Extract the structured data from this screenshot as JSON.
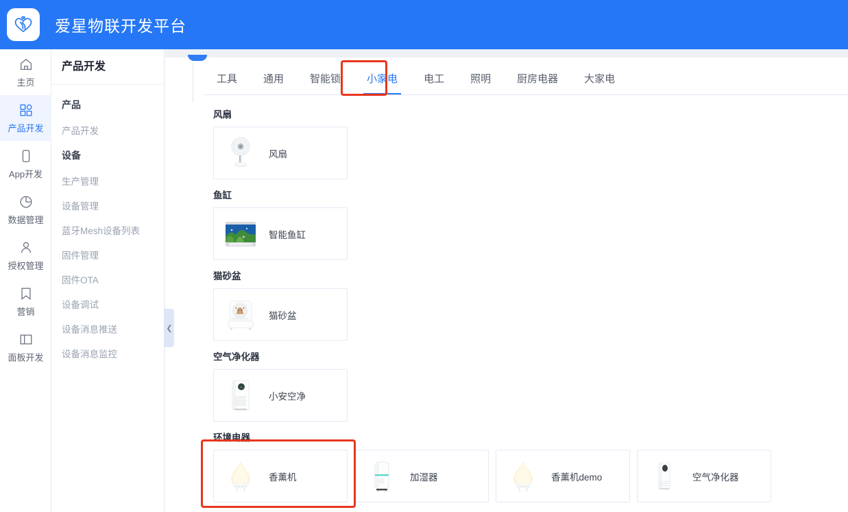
{
  "header": {
    "title": "爱星物联开发平台",
    "logo_icon": "heart-wifi-logo-icon",
    "brand_color": "#2577f5"
  },
  "rail": {
    "items": [
      {
        "label": "主页",
        "icon": "home-icon",
        "active": false
      },
      {
        "label": "产品开发",
        "icon": "grid-icon",
        "active": true
      },
      {
        "label": "App开发",
        "icon": "phone-icon",
        "active": false
      },
      {
        "label": "数据管理",
        "icon": "pie-chart-icon",
        "active": false
      },
      {
        "label": "授权管理",
        "icon": "user-icon",
        "active": false
      },
      {
        "label": "营销",
        "icon": "bookmark-icon",
        "active": false
      },
      {
        "label": "面板开发",
        "icon": "panel-icon",
        "active": false
      }
    ]
  },
  "submenu": {
    "title": "产品开发",
    "entries": [
      {
        "label": "产品",
        "type": "group"
      },
      {
        "label": "产品开发",
        "type": "item"
      },
      {
        "label": "设备",
        "type": "group"
      },
      {
        "label": "生产管理",
        "type": "item"
      },
      {
        "label": "设备管理",
        "type": "item"
      },
      {
        "label": "蓝牙Mesh设备列表",
        "type": "item"
      },
      {
        "label": "固件管理",
        "type": "item"
      },
      {
        "label": "固件OTA",
        "type": "item"
      },
      {
        "label": "设备调试",
        "type": "item"
      },
      {
        "label": "设备消息推送",
        "type": "item"
      },
      {
        "label": "设备消息监控",
        "type": "item"
      }
    ],
    "collapse_icon": "chevron-left-icon"
  },
  "tabs": [
    {
      "label": "工具",
      "active": false
    },
    {
      "label": "通用",
      "active": false
    },
    {
      "label": "智能锁",
      "active": false
    },
    {
      "label": "小家电",
      "active": true
    },
    {
      "label": "电工",
      "active": false
    },
    {
      "label": "照明",
      "active": false
    },
    {
      "label": "厨房电器",
      "active": false
    },
    {
      "label": "大家电",
      "active": false
    }
  ],
  "sections": [
    {
      "title": "风扇",
      "cards": [
        {
          "label": "风扇",
          "thumb": "pedestal-fan-thumb"
        }
      ]
    },
    {
      "title": "鱼缸",
      "cards": [
        {
          "label": "智能鱼缸",
          "thumb": "aquarium-thumb"
        }
      ]
    },
    {
      "title": "猫砂盆",
      "cards": [
        {
          "label": "猫砂盆",
          "thumb": "cat-litter-box-thumb"
        }
      ]
    },
    {
      "title": "空气净化器",
      "cards": [
        {
          "label": "小安空净",
          "thumb": "air-purifier-tower-thumb"
        }
      ]
    },
    {
      "title": "环境电器",
      "cards": [
        {
          "label": "香薰机",
          "thumb": "aroma-diffuser-thumb"
        },
        {
          "label": "加湿器",
          "thumb": "humidifier-thumb"
        },
        {
          "label": "香薰机demo",
          "thumb": "aroma-diffuser-thumb"
        },
        {
          "label": "空气净化器",
          "thumb": "air-purifier-slim-thumb"
        }
      ]
    }
  ],
  "annotations": {
    "color": "#e8361d",
    "tab_highlight": "小家电",
    "card_highlight": "香薰机"
  }
}
